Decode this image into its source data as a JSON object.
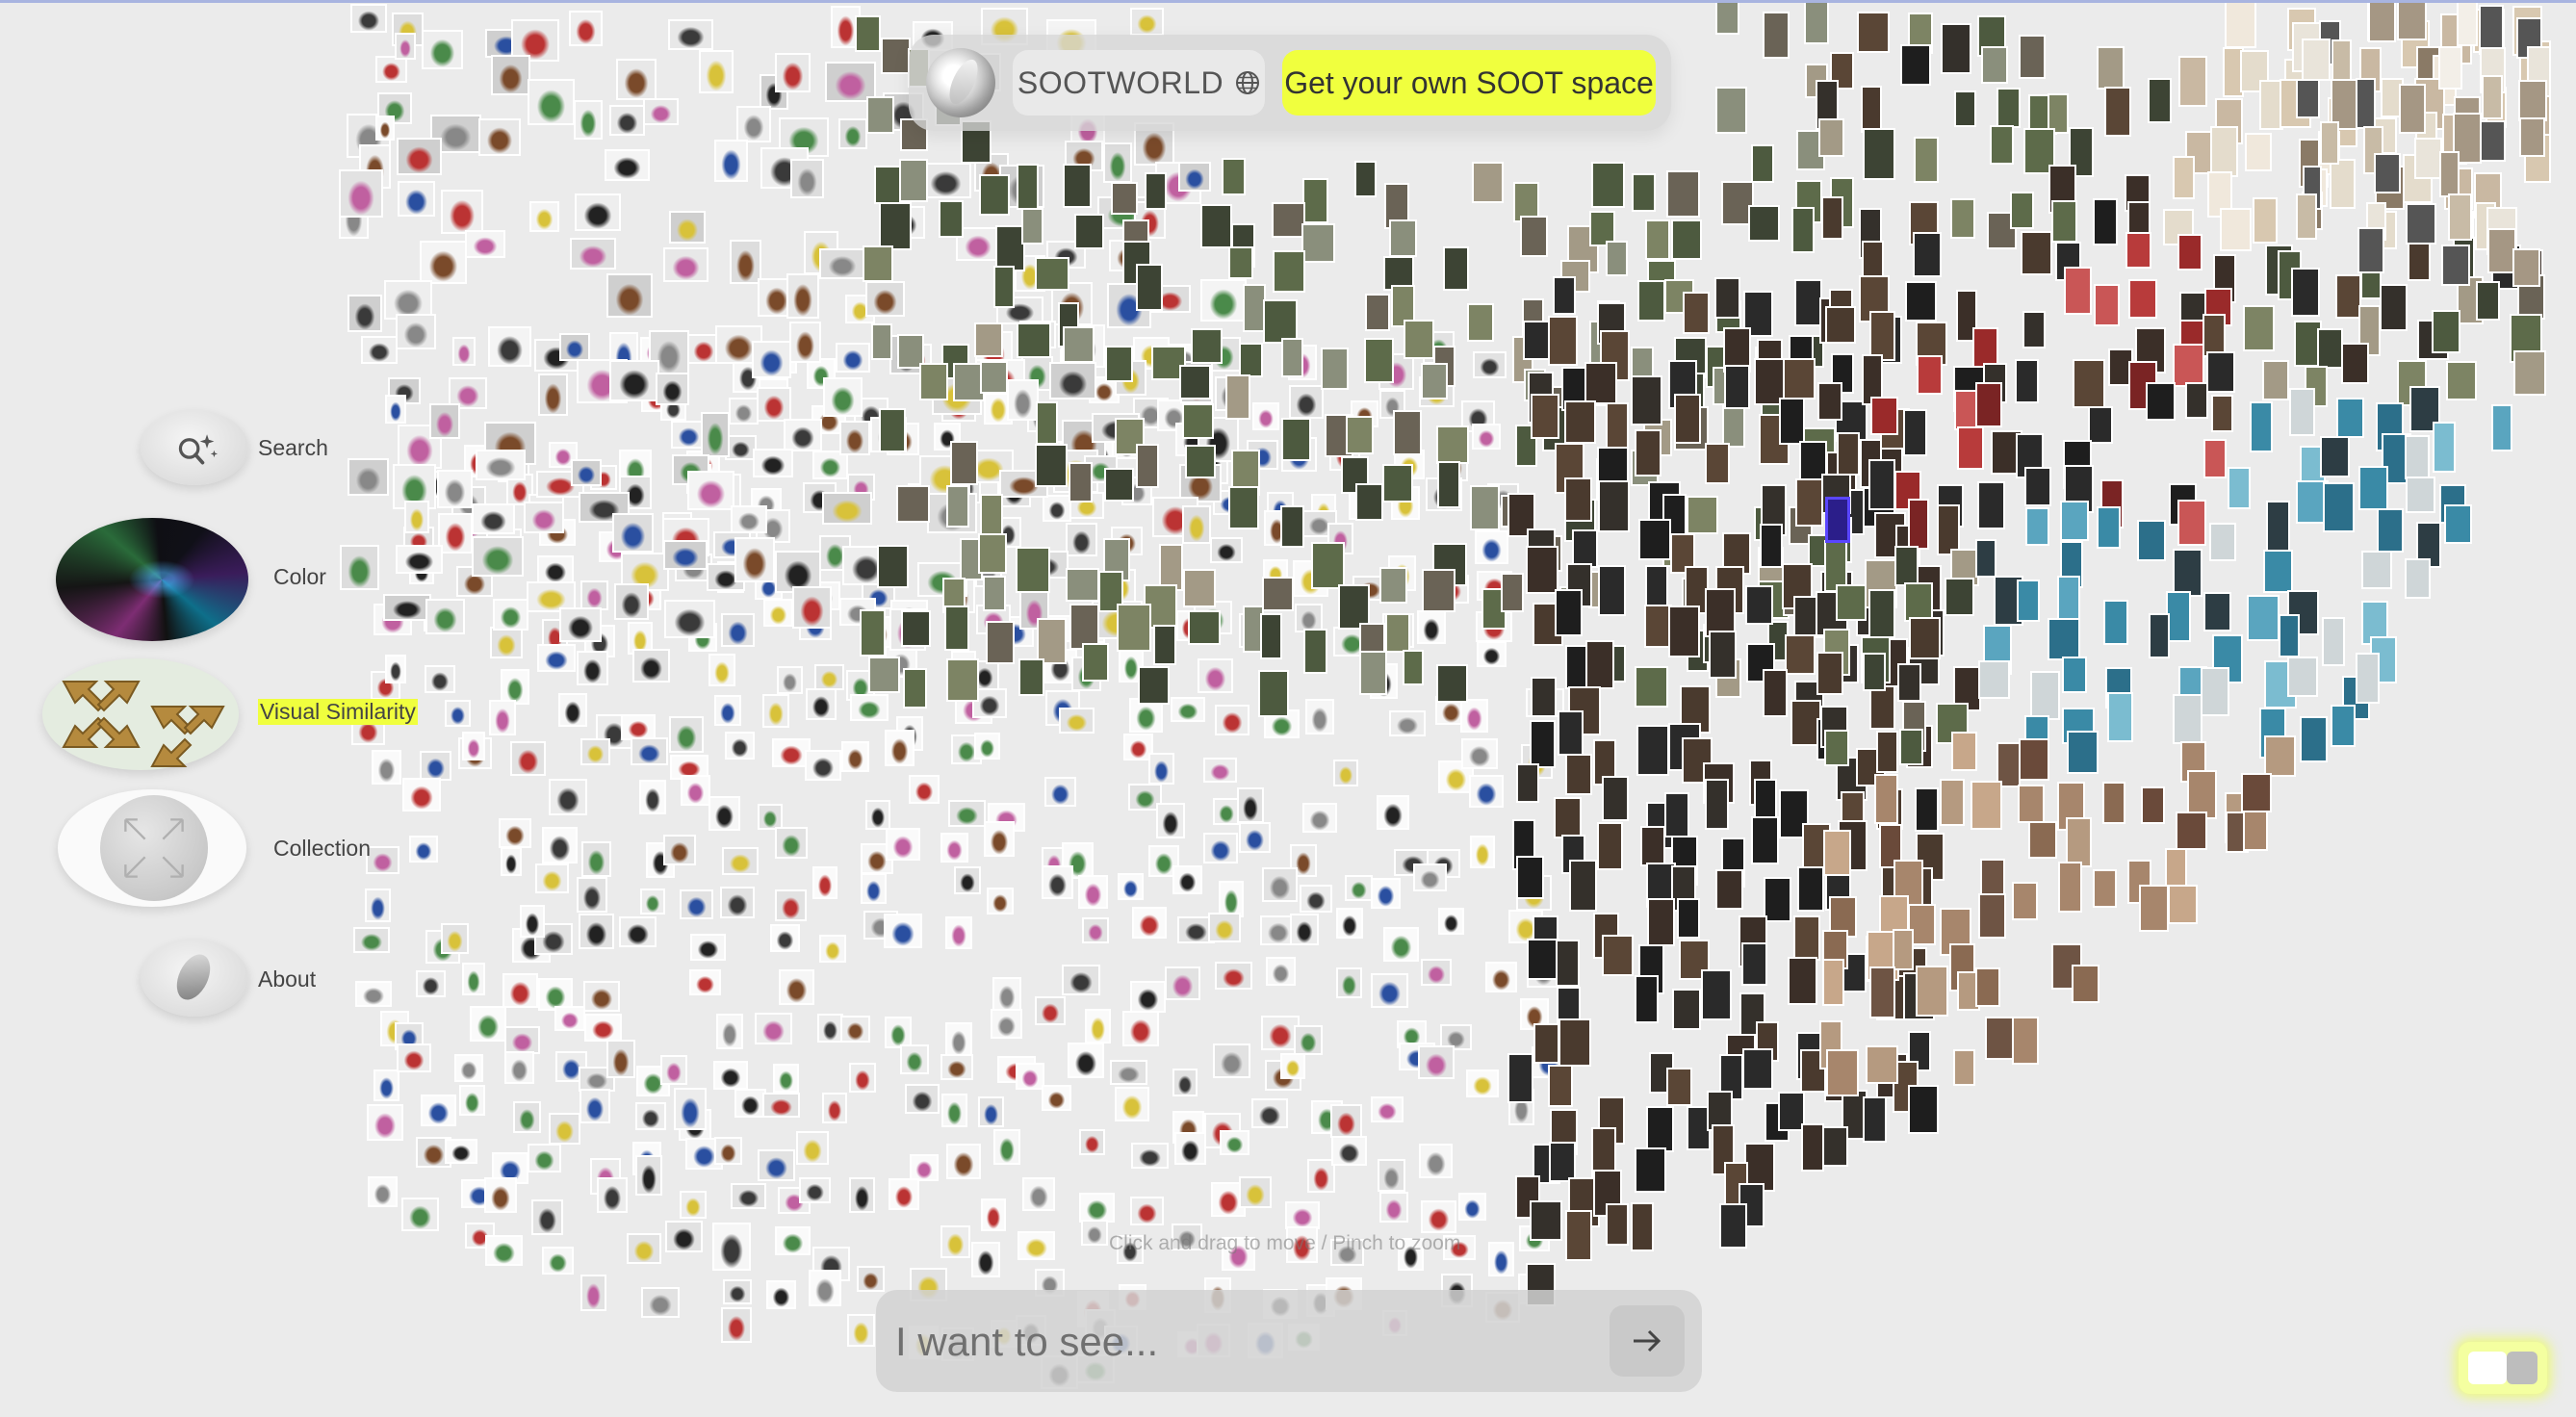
{
  "header": {
    "brand_label": "SOOTWORLD",
    "cta_label": "Get your own SOOT space"
  },
  "nav": {
    "items": [
      {
        "id": "search",
        "label": "Search"
      },
      {
        "id": "color",
        "label": "Color"
      },
      {
        "id": "visual_similarity",
        "label": "Visual Similarity",
        "active": true
      },
      {
        "id": "collection",
        "label": "Collection"
      },
      {
        "id": "about",
        "label": "About"
      }
    ]
  },
  "canvas": {
    "hint": "Click and drag to move / Pinch to zoom"
  },
  "search": {
    "placeholder": "I want to see..."
  },
  "colors": {
    "background": "#ebebeb",
    "accent_yellow": "#f0ff3e"
  },
  "icons": {
    "globe": "globe-icon",
    "search_sparkle": "search-sparkle-icon",
    "arrow": "arrow-right-icon",
    "logo": "soot-logo-icon"
  }
}
